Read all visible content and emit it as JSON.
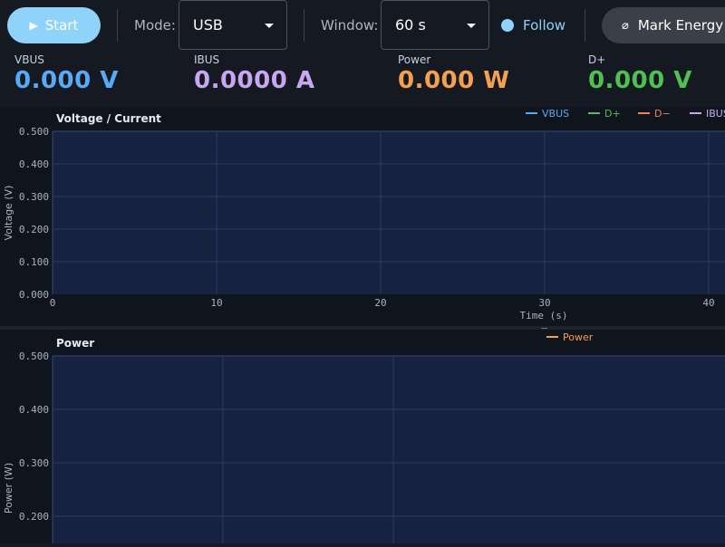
{
  "toolbar": {
    "start_label": "Start",
    "start_icon": "play-icon",
    "mode_label": "Mode:",
    "mode_value": "USB",
    "window_label": "Window:",
    "window_value": "60 s",
    "follow_label": "Follow",
    "mark_label": "Mark Energy",
    "mark_icon": "mark-icon"
  },
  "readouts": [
    {
      "label": "VBUS",
      "value": "0.000 V",
      "color": "#5aa9f5"
    },
    {
      "label": "IBUS",
      "value": "0.0000 A",
      "color": "#c9a6f2"
    },
    {
      "label": "Power",
      "value": "0.000 W",
      "color": "#f5a050"
    },
    {
      "label": "D+",
      "value": "0.000 V",
      "color": "#4fc052"
    }
  ],
  "colors": {
    "accent": "#8fd3fb",
    "plot_bg": "#172241",
    "grid": "#2a3a6a",
    "vbus": "#5aa9f5",
    "dplus": "#4fc052",
    "dminus": "#f0805a",
    "ibus": "#c9a6f2",
    "power": "#f5a050"
  },
  "chart_data": [
    {
      "type": "line",
      "title": "Voltage / Current",
      "xlabel": "Time (s)",
      "ylabel": "Voltage (V)",
      "xlim": [
        0,
        45
      ],
      "ylim": [
        0,
        0.5
      ],
      "x_ticks": [
        "0",
        "10",
        "20",
        "30",
        "40"
      ],
      "x_tick_values": [
        0,
        10,
        20,
        30,
        40
      ],
      "y_ticks": [
        "0.000",
        "0.100",
        "0.200",
        "0.300",
        "0.400",
        "0.500"
      ],
      "y_tick_values": [
        0,
        0.1,
        0.2,
        0.3,
        0.4,
        0.5
      ],
      "grid": true,
      "legend_position": "top-right",
      "series": [
        {
          "name": "VBUS",
          "color": "#5aa9f5",
          "values": []
        },
        {
          "name": "D+",
          "color": "#4fc052",
          "values": []
        },
        {
          "name": "D−",
          "color": "#f0805a",
          "values": []
        },
        {
          "name": "IBUS",
          "color": "#c9a6f2",
          "values": []
        }
      ]
    },
    {
      "type": "line",
      "title": "Power",
      "xlabel": "",
      "ylabel": "Power (W)",
      "xlim": [
        0,
        30
      ],
      "ylim": [
        0.2,
        0.5
      ],
      "x_ticks": [],
      "x_tick_values": [
        0,
        10,
        20
      ],
      "y_ticks": [
        "0.200",
        "0.300",
        "0.400",
        "0.500"
      ],
      "y_tick_values": [
        0.2,
        0.3,
        0.4,
        0.5
      ],
      "grid": true,
      "legend_position": "top-center",
      "series": [
        {
          "name": "Power",
          "color": "#f5a050",
          "values": []
        }
      ]
    }
  ]
}
